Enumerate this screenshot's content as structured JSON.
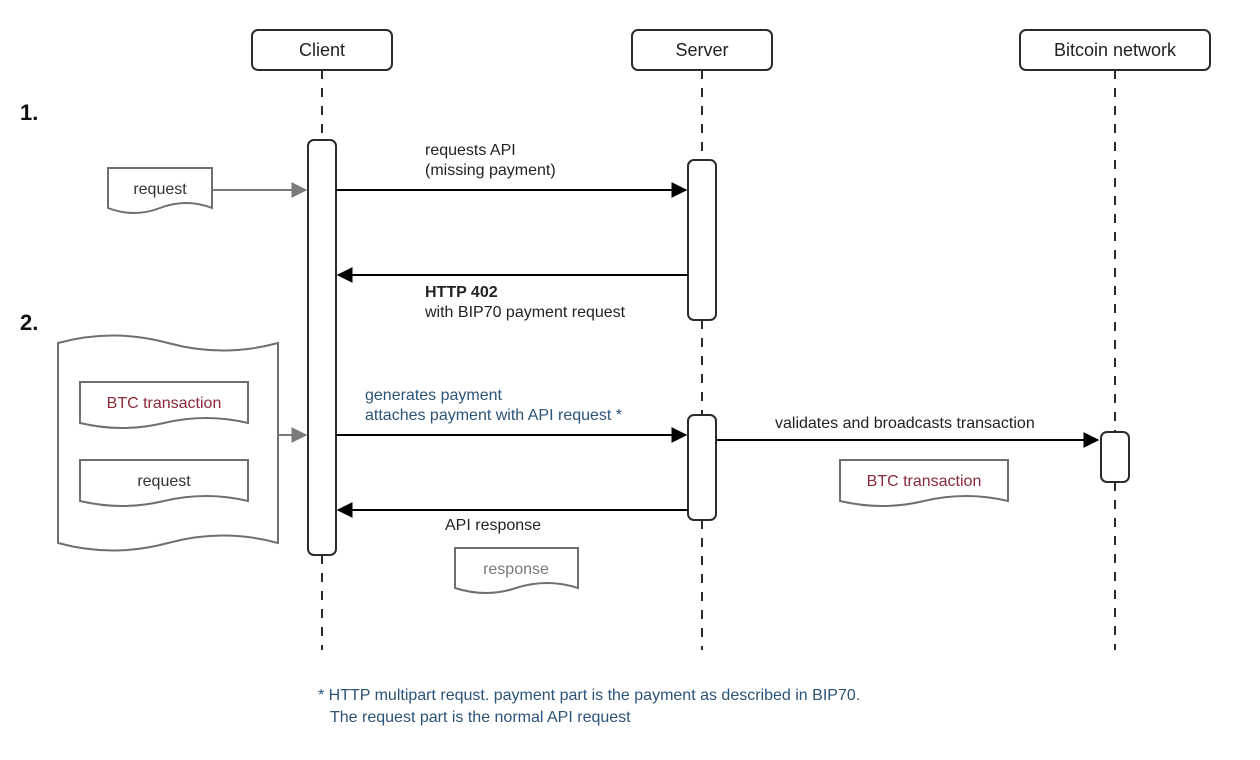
{
  "participants": {
    "client": "Client",
    "server": "Server",
    "network": "Bitcoin network"
  },
  "steps": {
    "one": "1.",
    "two": "2."
  },
  "notes": {
    "request1": "request",
    "btc_tx": "BTC transaction",
    "request2": "request",
    "response": "response",
    "btc_tx_server": "BTC transaction"
  },
  "messages": {
    "m1_line1": "requests API",
    "m1_line2": "(missing payment)",
    "m2_line1": "HTTP 402",
    "m2_line2": "with BIP70 payment request",
    "m3_line1": "generates payment",
    "m3_line2": "attaches payment with API request *",
    "m4": "API response",
    "m5": "validates and broadcasts transaction"
  },
  "footnote": {
    "l1": "* HTTP multipart requst. payment part is the payment as described in BIP70.",
    "l2": "The request part is the normal API request"
  }
}
